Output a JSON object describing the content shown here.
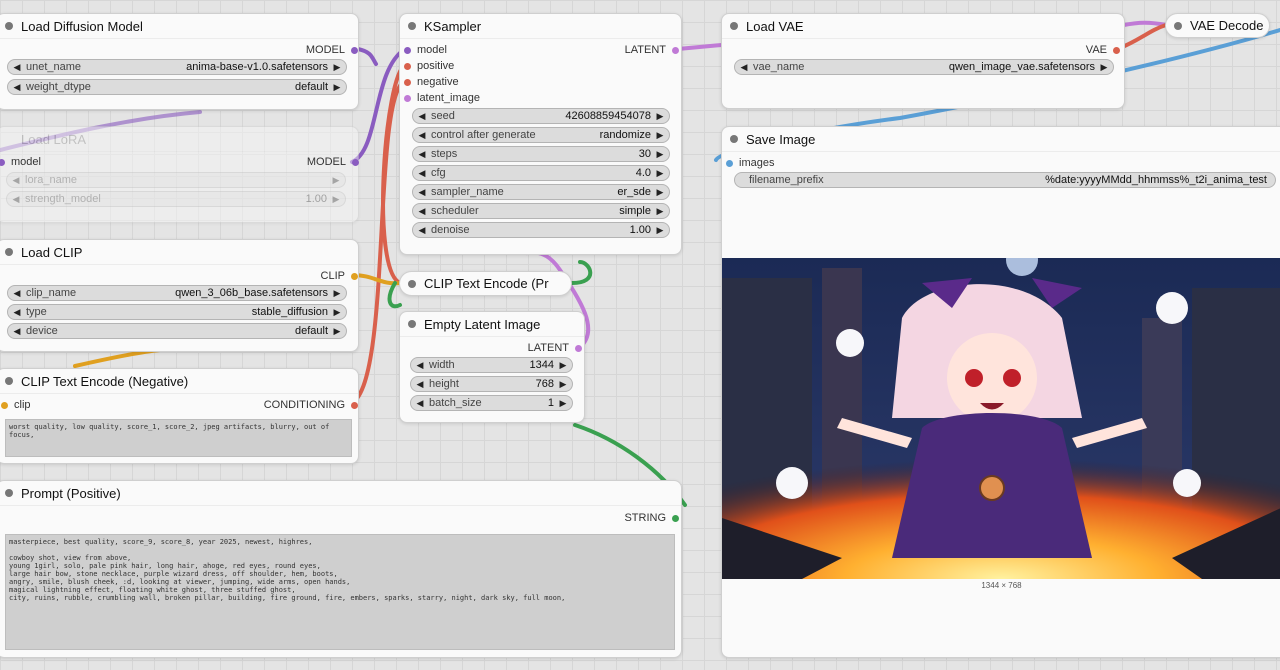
{
  "colors": {
    "model": "#8a5cc0",
    "clip": "#e0a020",
    "conditioning": "#d9604c",
    "latent": "#c07ad6",
    "vae": "#d9604c",
    "image": "#5a9fd6",
    "string": "#3aa050"
  },
  "nodes": {
    "load_diffusion": {
      "title": "Load Diffusion Model",
      "out_model": "MODEL",
      "unet_label": "unet_name",
      "unet_value": "anima-base-v1.0.safetensors",
      "dtype_label": "weight_dtype",
      "dtype_value": "default"
    },
    "load_lora": {
      "title": "Load LoRA",
      "in_model": "model",
      "out_model": "MODEL",
      "lora_label": "lora_name",
      "strength_label": "strength_model",
      "strength_value": "1.00"
    },
    "load_clip": {
      "title": "Load CLIP",
      "out_clip": "CLIP",
      "clip_label": "clip_name",
      "clip_value": "qwen_3_06b_base.safetensors",
      "type_label": "type",
      "type_value": "stable_diffusion",
      "device_label": "device",
      "device_value": "default"
    },
    "clip_neg": {
      "title": "CLIP Text Encode (Negative)",
      "in_clip": "clip",
      "out_cond": "CONDITIONING",
      "text": "worst quality, low quality, score_1, score_2, jpeg artifacts, blurry, out of focus,"
    },
    "prompt_pos": {
      "title": "Prompt (Positive)",
      "out_string": "STRING",
      "text": "masterpiece, best quality, score_9, score_8, year 2025, newest, highres,\n\ncowboy shot, view from above,\nyoung 1girl, solo, pale pink hair, long hair, ahoge, red eyes, round eyes,\nlarge hair bow, stone necklace, purple wizard dress, off shoulder, hem, boots,\nangry, smile, blush cheek, :d, looking at viewer, jumping, wide arms, open hands,\nmagical lightning effect, floating white ghost, three stuffed ghost,\ncity, ruins, rubble, crumbling wall, broken pillar, building, fire ground, fire, embers, sparks, starry, night, dark sky, full moon,"
    },
    "ksampler": {
      "title": "KSampler",
      "in_model": "model",
      "in_positive": "positive",
      "in_negative": "negative",
      "in_latent": "latent_image",
      "out_latent": "LATENT",
      "widgets": [
        {
          "label": "seed",
          "value": "426088594540​78"
        },
        {
          "label": "control after generate",
          "value": "randomize"
        },
        {
          "label": "steps",
          "value": "30"
        },
        {
          "label": "cfg",
          "value": "4.0"
        },
        {
          "label": "sampler_name",
          "value": "er_sde"
        },
        {
          "label": "scheduler",
          "value": "simple"
        },
        {
          "label": "denoise",
          "value": "1.00"
        }
      ]
    },
    "clip_pos": {
      "title": "CLIP Text Encode (Pr"
    },
    "empty_latent": {
      "title": "Empty Latent Image",
      "out_latent": "LATENT",
      "width_label": "width",
      "width_value": "1344",
      "height_label": "height",
      "height_value": "768",
      "batch_label": "batch_size",
      "batch_value": "1"
    },
    "load_vae": {
      "title": "Load VAE",
      "out_vae": "VAE",
      "vae_label": "vae_name",
      "vae_value": "qwen_image_vae.safetensors"
    },
    "vae_decode": {
      "title": "VAE Decode"
    },
    "save_image": {
      "title": "Save Image",
      "in_images": "images",
      "prefix_label": "filename_prefix",
      "prefix_value": "%date:yyyyMMdd_hhmmss%_t2i_anima_test",
      "caption": "1344 × 768"
    }
  }
}
